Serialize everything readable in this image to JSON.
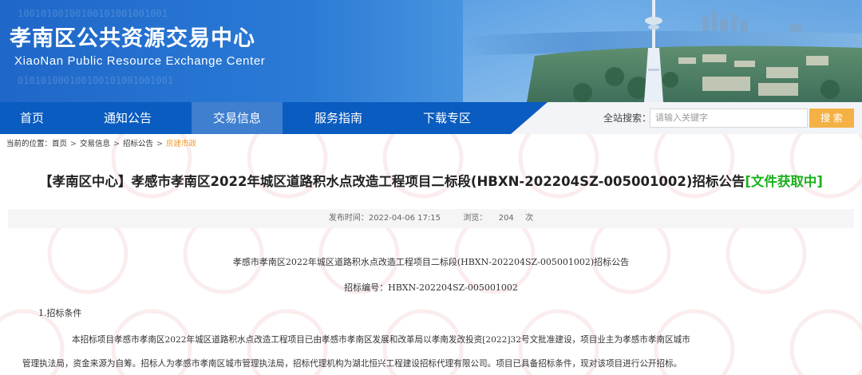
{
  "header": {
    "title_cn": "孝南区公共资源交易中心",
    "title_en": "XiaoNan Public Resource Exchange Center",
    "binary_1": "10010100100100101001001001",
    "binary_2": "010101000100100101001001001"
  },
  "nav": {
    "items": [
      {
        "label": "首页"
      },
      {
        "label": "通知公告"
      },
      {
        "label": "交易信息"
      },
      {
        "label": "服务指南"
      },
      {
        "label": "下载专区"
      }
    ],
    "active_index": 2,
    "search": {
      "label": "全站搜索：",
      "placeholder": "请输入关键字",
      "button": "搜 索"
    }
  },
  "breadcrumb": {
    "prefix": "当前的位置：",
    "items": [
      "首页",
      "交易信息",
      "招标公告",
      "房建市政"
    ],
    "separator": ">"
  },
  "article": {
    "title_main": "【孝南区中心】孝感市孝南区2022年城区道路积水点改造工程项目二标段(HBXN-202204SZ-005001002)招标公告",
    "title_tag": "[文件获取中]",
    "publish_label": "发布时间：",
    "publish_time": "2022-04-06 17:15",
    "views_label": "浏览：",
    "views_count": "204",
    "views_unit": "次",
    "body": {
      "subtitle": "孝感市孝南区2022年城区道路积水点改造工程项目二标段(HBXN-202204SZ-005001002)招标公告",
      "code_line": "招标编号：HBXN-202204SZ-005001002",
      "section_1": "1.招标条件",
      "para_1_line_1": "本招标项目孝感市孝南区2022年城区道路积水点改造工程项目已由孝感市孝南区发展和改革局以孝南发改投资[2022]32号文批准建设，项目业主为孝感市孝南区城市",
      "para_1_line_2": "管理执法局，资金来源为自筹。招标人为孝感市孝南区城市管理执法局，招标代理机构为湖北恒兴工程建设招标代理有限公司。项目已具备招标条件，现对该项目进行公开招标。"
    }
  },
  "colors": {
    "nav_bg": "#0a5cc0",
    "nav_active": "#3f7fd0",
    "search_button": "#f4b246",
    "tag_green": "#1bb01b",
    "crumb_current": "#f09a2a"
  }
}
